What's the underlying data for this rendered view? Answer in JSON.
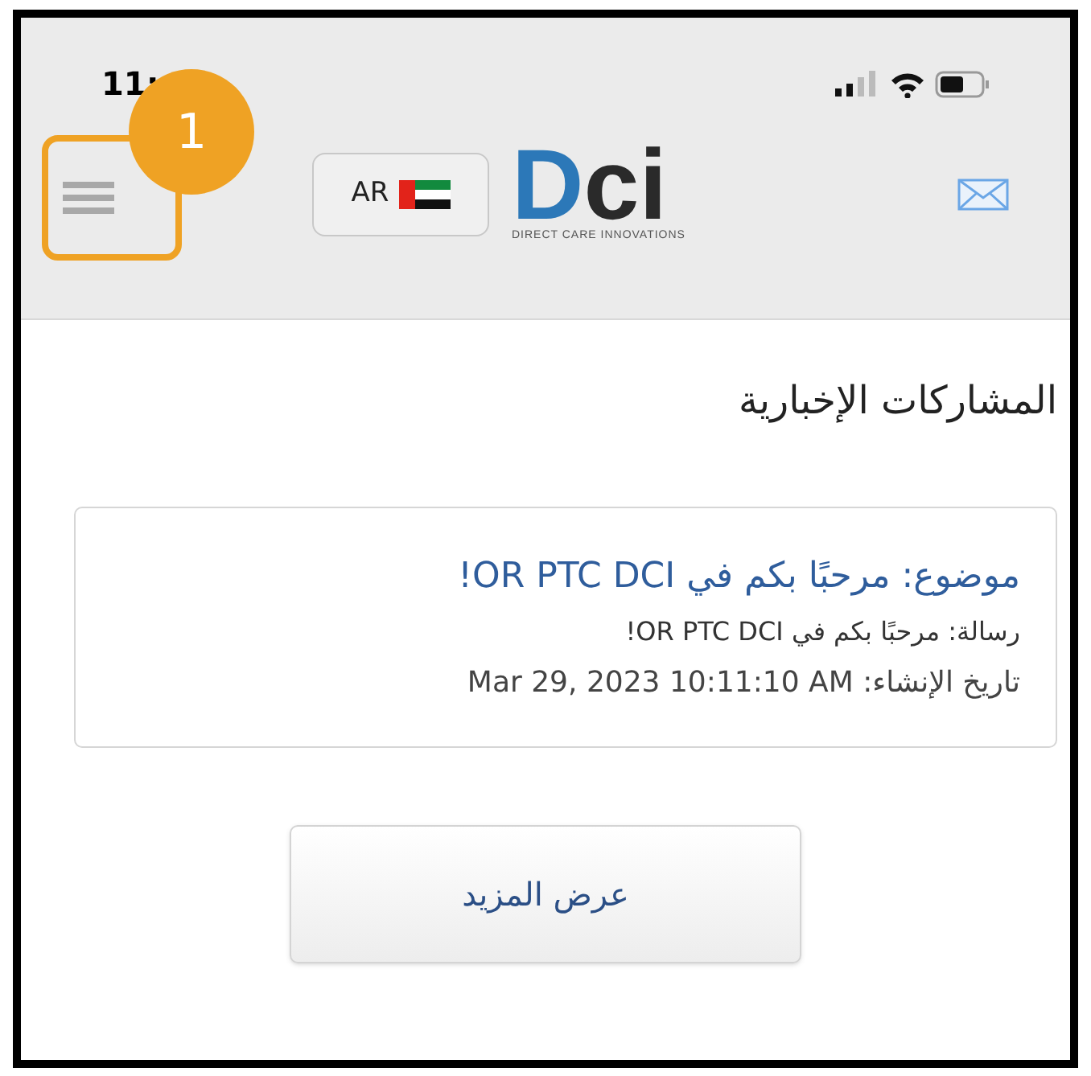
{
  "status_bar": {
    "time": "11:"
  },
  "header": {
    "language": "AR",
    "logo": {
      "wordmark_1": "D",
      "wordmark_2": "ci",
      "tagline": "DIRECT CARE INNOVATIONS"
    }
  },
  "annotation": {
    "number": "1"
  },
  "page_title": "المشاركات الإخبارية",
  "posts": [
    {
      "subject": "موضوع: مرحبًا بكم في OR PTC DCI!",
      "message": "رسالة: مرحبًا بكم في OR PTC DCI!",
      "created": "تاريخ الإنشاء: Mar 29, 2023 10:11:10 AM"
    }
  ],
  "more_button": "عرض المزيد"
}
